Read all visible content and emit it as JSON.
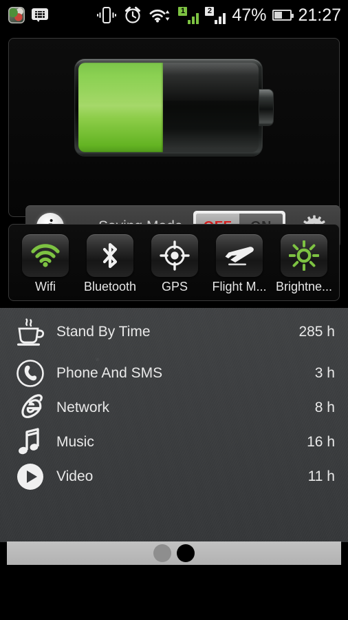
{
  "statusbar": {
    "notification_icons": [
      {
        "name": "photo-app-icon",
        "label": "Gallery"
      },
      {
        "name": "bbm-icon",
        "label": "BBM"
      }
    ],
    "system_icons": [
      {
        "name": "vibrate-icon"
      },
      {
        "name": "alarm-clock-icon"
      },
      {
        "name": "wifi-data-icon"
      }
    ],
    "sim1_badge": "1",
    "sim2_badge": "2",
    "battery_percent": "47%",
    "clock": "21:27",
    "colors": {
      "sim1_accent": "#7dc242",
      "sim2_accent": "#e9e9e9",
      "text": "#f2f2f2"
    }
  },
  "battery_card": {
    "level_percent": 47,
    "fill_color": "#7ccb3c",
    "graphic_name": "battery-level-graphic"
  },
  "saving_mode": {
    "info_icon": "info-icon",
    "label": "Saving Mode",
    "toggle": {
      "off_label": "OFF",
      "on_label": "ON",
      "selected": "OFF",
      "off_color": "#d21f1f"
    },
    "settings_icon": "gear-icon"
  },
  "quick_toggles": [
    {
      "label": "Wifi",
      "icon": "wifi-icon",
      "state": "on",
      "color": "#7dc242"
    },
    {
      "label": "Bluetooth",
      "icon": "bluetooth-icon",
      "state": "off",
      "color": "#f0f0f0"
    },
    {
      "label": "GPS",
      "icon": "gps-icon",
      "state": "off",
      "color": "#f0f0f0"
    },
    {
      "label": "Flight M...",
      "icon": "airplane-icon",
      "state": "off",
      "color": "#f0f0f0"
    },
    {
      "label": "Brightne...",
      "icon": "brightness-icon",
      "state": "on",
      "color": "#7dc242"
    }
  ],
  "stats": [
    {
      "icon": "coffee-cup-icon",
      "name": "Stand By Time",
      "value": "285 h"
    },
    {
      "icon": "phone-icon",
      "name": "Phone And SMS",
      "value": "3 h"
    },
    {
      "icon": "internet-explorer-icon",
      "name": "Network",
      "value": "8 h"
    },
    {
      "icon": "music-note-icon",
      "name": "Music",
      "value": "16 h"
    },
    {
      "icon": "play-button-icon",
      "name": "Video",
      "value": "11 h"
    }
  ],
  "pager": {
    "pages": 2,
    "active_index": 1
  }
}
